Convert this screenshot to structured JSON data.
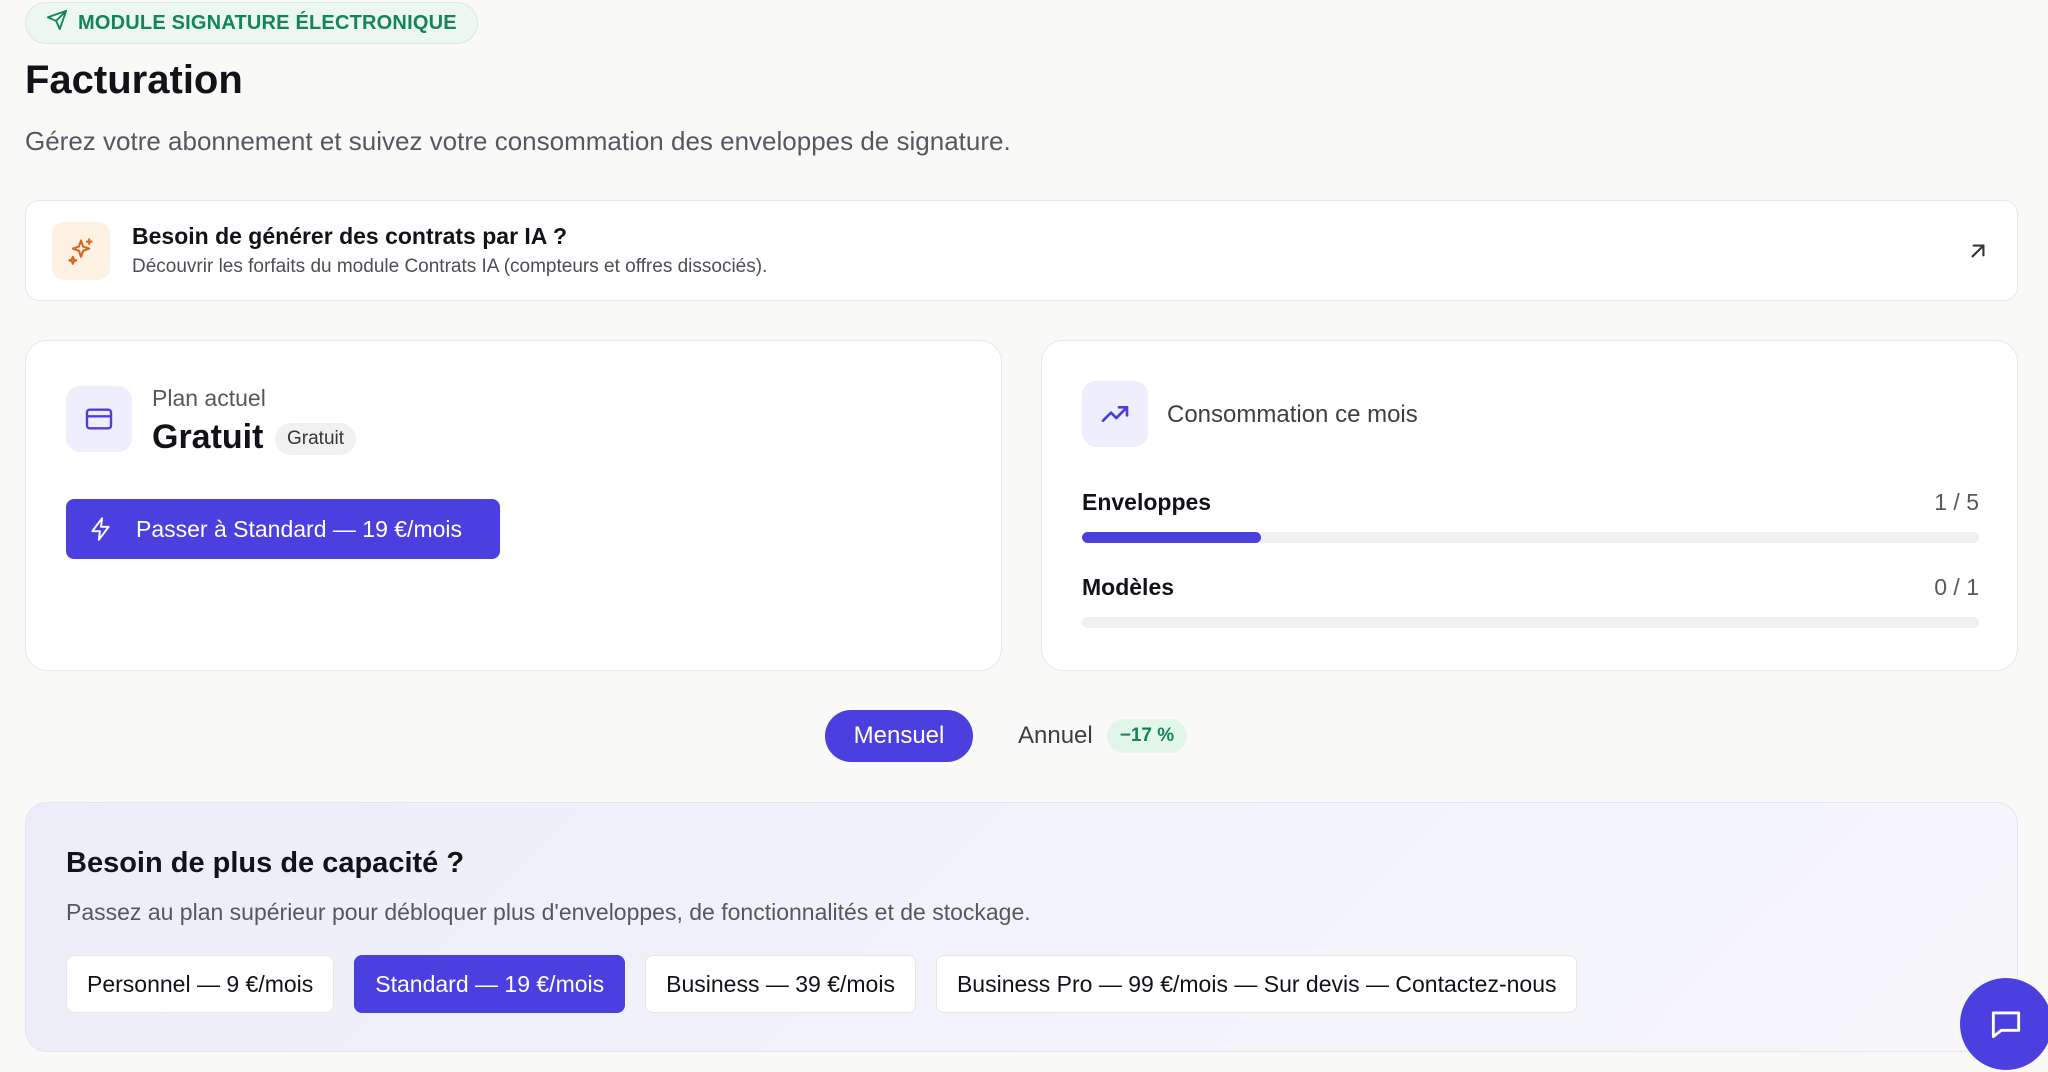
{
  "module_badge": {
    "label": "MODULE SIGNATURE ÉLECTRONIQUE",
    "icon": "send-icon"
  },
  "header": {
    "title": "Facturation",
    "subtitle": "Gérez votre abonnement et suivez votre consommation des enveloppes de signature."
  },
  "promo": {
    "title": "Besoin de générer des contrats par IA ?",
    "description": "Découvrir les forfaits du module Contrats IA (compteurs et offres dissociés).",
    "icon": "sparkles-icon",
    "link_icon": "arrow-up-right-icon"
  },
  "plan": {
    "label": "Plan actuel",
    "name": "Gratuit",
    "badge": "Gratuit",
    "icon": "credit-card-icon",
    "upgrade_label": "Passer à Standard — 19 €/mois",
    "upgrade_icon": "lightning-icon"
  },
  "usage": {
    "title": "Consommation ce mois",
    "icon": "trending-up-icon",
    "meters": [
      {
        "name": "Enveloppes",
        "count": "1 / 5",
        "used": 1,
        "limit": 5
      },
      {
        "name": "Modèles",
        "count": "0 / 1",
        "used": 0,
        "limit": 1
      }
    ]
  },
  "billing_toggle": {
    "monthly": "Mensuel",
    "annual": "Annuel",
    "discount": "−17 %",
    "selected": "monthly"
  },
  "capacity": {
    "title": "Besoin de plus de capacité ?",
    "description": "Passez au plan supérieur pour débloquer plus d'enveloppes, de fonctionnalités et de stockage.",
    "plans": [
      {
        "label": "Personnel — 9 €/mois",
        "active": false
      },
      {
        "label": "Standard — 19 €/mois",
        "active": true
      },
      {
        "label": "Business — 39 €/mois",
        "active": false
      },
      {
        "label": "Business Pro — 99 €/mois — Sur devis — Contactez-nous",
        "active": false
      }
    ]
  },
  "chat": {
    "icon": "chat-bubble-icon"
  },
  "colors": {
    "accent": "#4b3fe0",
    "success": "#14855a",
    "background": "#f9f9f8"
  }
}
